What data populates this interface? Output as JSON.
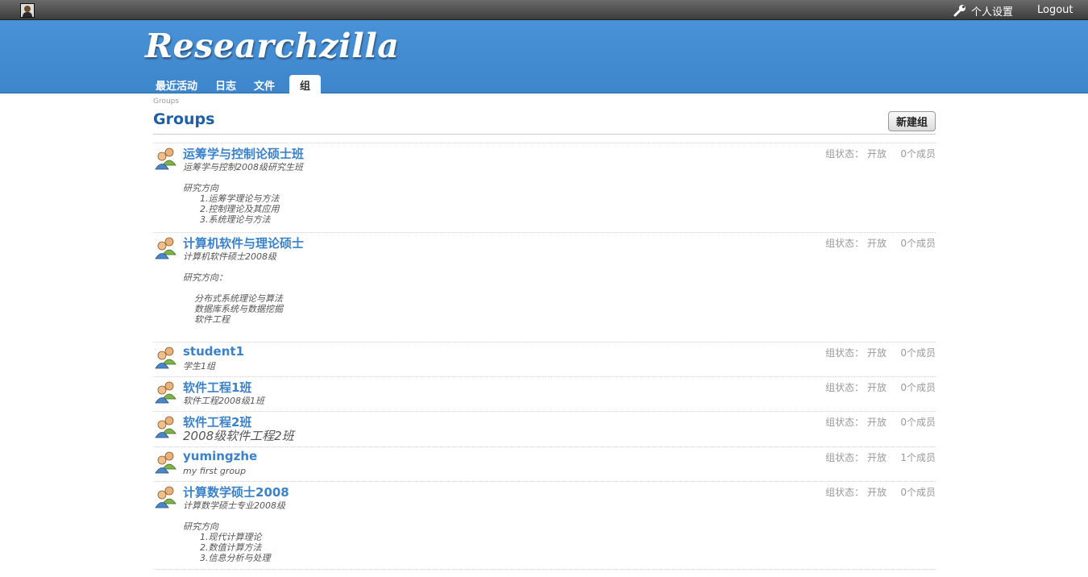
{
  "topbar": {
    "settings_label": "个人设置",
    "logout_label": "Logout"
  },
  "header": {
    "logo": "Researchzilla",
    "tabs": [
      {
        "label": "最近活动",
        "active": false
      },
      {
        "label": "日志",
        "active": false
      },
      {
        "label": "文件",
        "active": false
      },
      {
        "label": "组",
        "active": true
      }
    ]
  },
  "breadcrumb": "Groups",
  "page_title": "Groups",
  "new_group_button": "新建组",
  "groups": [
    {
      "name": "运筹学与控制论硕士班",
      "description": "运筹学与控制2008级研究生班\n\n研究方向\n      1.运筹学理论与方法\n      2.控制理论及其应用\n      3.系统理论与方法",
      "status": "组状态： 开放",
      "members": "0个成员"
    },
    {
      "name": "计算机软件与理论硕士",
      "description": "计算机软件硕士2008级\n\n研究方向：\n\n    分布式系统理论与算法\n    数据库系统与数据挖掘\n    软件工程",
      "status": "组状态： 开放",
      "members": "0个成员"
    },
    {
      "name": "student1",
      "description": "学生1组",
      "status": "组状态： 开放",
      "members": "0个成员"
    },
    {
      "name": "软件工程1班",
      "description": "软件工程2008级1班",
      "status": "组状态： 开放",
      "members": "0个成员"
    },
    {
      "name": "软件工程2班",
      "description": "2008级软件工程2班",
      "status": "组状态： 开放",
      "members": "0个成员"
    },
    {
      "name": "yumingzhe",
      "description": "my first group",
      "status": "组状态： 开放",
      "members": "1个成员"
    },
    {
      "name": "计算数学硕士2008",
      "description": "计算数学硕士专业2008级\n\n研究方向\n      1.现代计算理论\n      2.数值计算方法\n      3.信息分析与处理",
      "status": "组状态： 开放",
      "members": "0个成员"
    }
  ]
}
